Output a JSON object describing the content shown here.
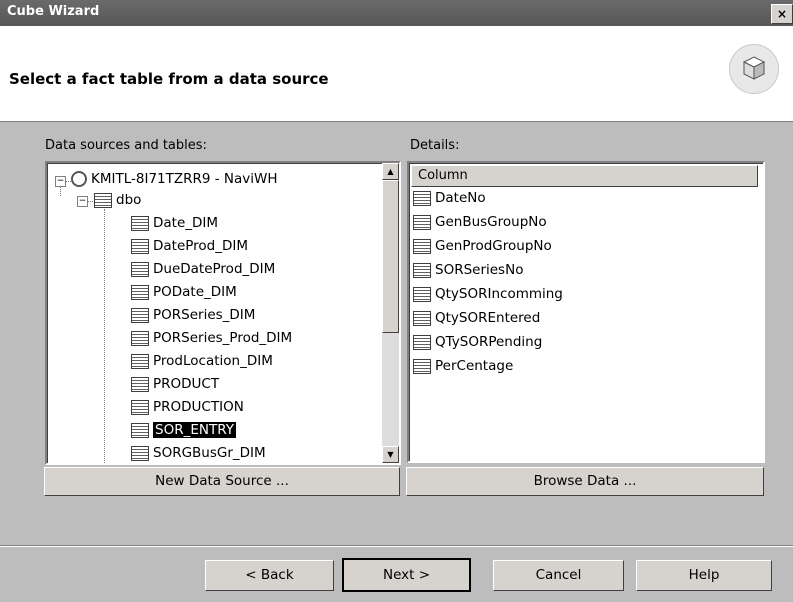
{
  "window": {
    "title": "Cube Wizard",
    "close_glyph": "×"
  },
  "header": {
    "title": "Select a fact table from a data source"
  },
  "left": {
    "label": "Data sources and tables:",
    "server": "KMITL-8I71TZRR9 - NaviWH",
    "schema": "dbo",
    "tables": [
      "Date_DIM",
      "DateProd_DIM",
      "DueDateProd_DIM",
      "PODate_DIM",
      "PORSeries_DIM",
      "PORSeries_Prod_DIM",
      "ProdLocation_DIM",
      "PRODUCT",
      "PRODUCTION",
      "SOR_ENTRY",
      "SORGBusGr_DIM"
    ],
    "selected": "SOR_ENTRY"
  },
  "right": {
    "label": "Details:",
    "column_header": "Column",
    "columns": [
      "DateNo",
      "GenBusGroupNo",
      "GenProdGroupNo",
      "SORSeriesNo",
      "QtySORIncomming",
      "QtySOREntered",
      "QTySORPending",
      "PerCentage"
    ]
  },
  "buttons": {
    "new_data_source": "New Data Source ...",
    "browse_data": "Browse Data ...",
    "back": "< Back",
    "next": "Next >",
    "cancel": "Cancel",
    "help": "Help"
  },
  "icons": {
    "cube": "cube-icon",
    "table": "table-icon",
    "server": "server-icon"
  }
}
